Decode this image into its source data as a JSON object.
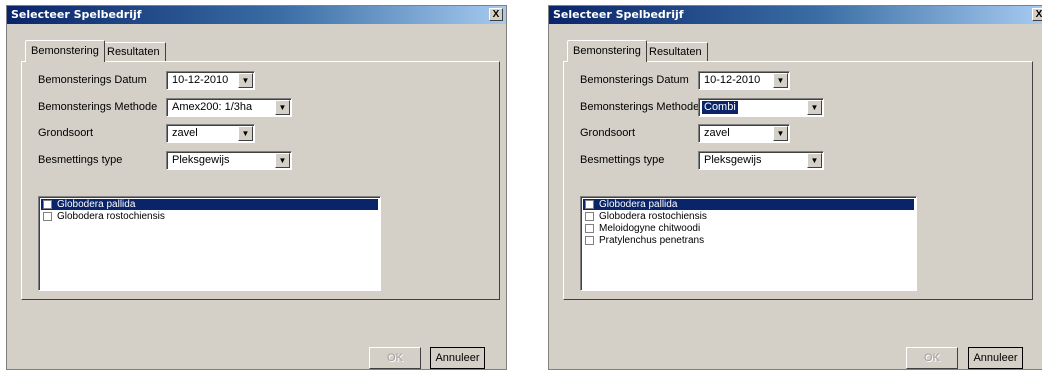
{
  "dialogs": [
    {
      "title": "Selecteer Spelbedrijf",
      "close_label": "X",
      "tabs": [
        {
          "label": "Bemonstering"
        },
        {
          "label": "Resultaten"
        }
      ],
      "fields": [
        {
          "label": "Bemonsterings Datum",
          "value": "10-12-2010"
        },
        {
          "label": "Bemonsterings Methode",
          "value": "Amex200: 1/3ha"
        },
        {
          "label": "Grondsoort",
          "value": "zavel"
        },
        {
          "label": "Besmettings type",
          "value": "Pleksgewijs"
        }
      ],
      "list_items": [
        {
          "label": "Globodera pallida",
          "checked": false,
          "selected": true
        },
        {
          "label": "Globodera rostochiensis",
          "checked": false,
          "selected": false
        }
      ],
      "ok_label": "OK",
      "cancel_label": "Annuleer"
    },
    {
      "title": "Selecteer Spelbedrijf",
      "close_label": "X",
      "tabs": [
        {
          "label": "Bemonstering"
        },
        {
          "label": "Resultaten"
        }
      ],
      "fields": [
        {
          "label": "Bemonsterings Datum",
          "value": "10-12-2010"
        },
        {
          "label": "Bemonsterings Methode",
          "value": "Combi"
        },
        {
          "label": "Grondsoort",
          "value": "zavel"
        },
        {
          "label": "Besmettings type",
          "value": "Pleksgewijs"
        }
      ],
      "list_items": [
        {
          "label": "Globodera pallida",
          "checked": false,
          "selected": true
        },
        {
          "label": "Globodera rostochiensis",
          "checked": false,
          "selected": false
        },
        {
          "label": "Meloidogyne chitwoodi",
          "checked": false,
          "selected": false
        },
        {
          "label": "Pratylenchus penetrans",
          "checked": false,
          "selected": false
        }
      ],
      "ok_label": "OK",
      "cancel_label": "Annuleer"
    }
  ]
}
